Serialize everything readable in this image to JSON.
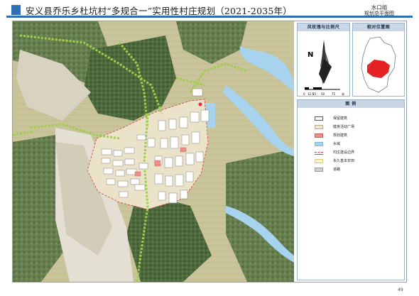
{
  "header": {
    "title": "安义县乔乐乡杜坑村“多规合一”实用性村庄规划（2021-2035年）",
    "village": "水口组",
    "plan_name": "规划总平面图"
  },
  "panels": {
    "compass_title": "风玫瑰与比例尺",
    "north_label": "N",
    "scale_ticks": [
      "0",
      "12.5",
      "25",
      "50",
      "75"
    ],
    "scale_unit": "米",
    "location_title": "相对位置图",
    "legend_title": "图  例"
  },
  "legend": [
    {
      "label": "保留建筑",
      "color": "#ffffff",
      "border": "#555555"
    },
    {
      "label": "健身活动广场",
      "color": "#efe6cc",
      "border": "#b9ad8a"
    },
    {
      "label": "规划建筑",
      "color": "#f08c8c",
      "border": "#c55b5b"
    },
    {
      "label": "水域",
      "color": "#a7d3ee",
      "border": "#7fb6d8"
    },
    {
      "label": "村庄建设边界",
      "color": "#ffffff",
      "border": "#d23c3c"
    },
    {
      "label": "永久基本农田",
      "color": "#fbf5c6",
      "border": "#d8c97a"
    },
    {
      "label": "道路",
      "color": "#cfcfcf",
      "border": "#9a9a9a"
    }
  ],
  "page": {
    "number": "49"
  }
}
